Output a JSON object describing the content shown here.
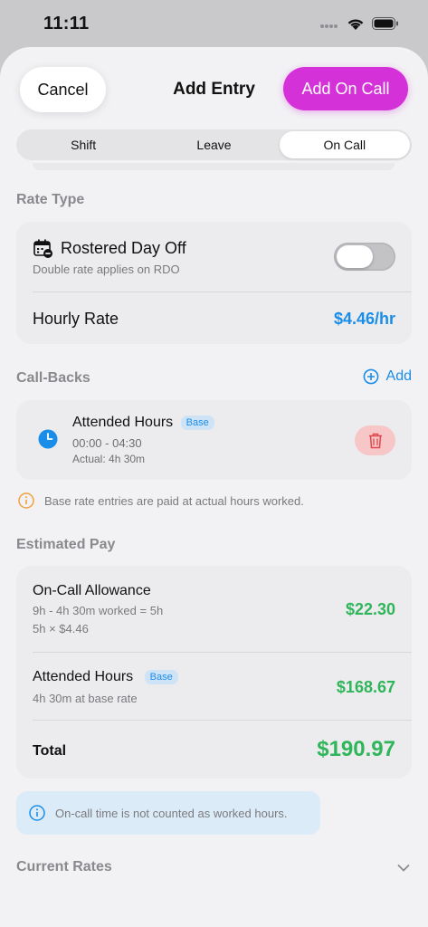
{
  "status_bar": {
    "time": "11:11"
  },
  "nav": {
    "cancel_label": "Cancel",
    "title": "Add Entry",
    "primary_label": "Add On Call"
  },
  "tabs": [
    {
      "label": "Shift",
      "active": false
    },
    {
      "label": "Leave",
      "active": false
    },
    {
      "label": "On Call",
      "active": true
    }
  ],
  "rate_type": {
    "header": "Rate Type",
    "rdo_title": "Rostered Day Off",
    "rdo_subtitle": "Double rate applies on RDO",
    "rdo_enabled": false,
    "hourly_label": "Hourly Rate",
    "hourly_value": "$4.46/hr"
  },
  "callbacks": {
    "header": "Call-Backs",
    "add_label": "Add",
    "items": [
      {
        "title": "Attended Hours",
        "badge": "Base",
        "time": "00:00 - 04:30",
        "actual": "Actual: 4h 30m"
      }
    ],
    "note": "Base rate entries are paid at actual hours worked."
  },
  "estimated_pay": {
    "header": "Estimated Pay",
    "allowance_title": "On-Call Allowance",
    "allowance_line1": "9h - 4h 30m worked = 5h",
    "allowance_line2": "5h × $4.46",
    "allowance_value": "$22.30",
    "attended_title": "Attended Hours",
    "attended_badge": "Base",
    "attended_sub": "4h 30m at base rate",
    "attended_value": "$168.67",
    "total_label": "Total",
    "total_value": "$190.97"
  },
  "info_note": "On-call time is not counted as worked hours.",
  "current_rates": {
    "header": "Current Rates"
  },
  "colors": {
    "accent": "#d531d8",
    "link": "#1a8de8",
    "money": "#2fb55a",
    "warning": "#f0a040",
    "delete_bg": "#f7c6c6",
    "delete_icon": "#e0474c"
  }
}
